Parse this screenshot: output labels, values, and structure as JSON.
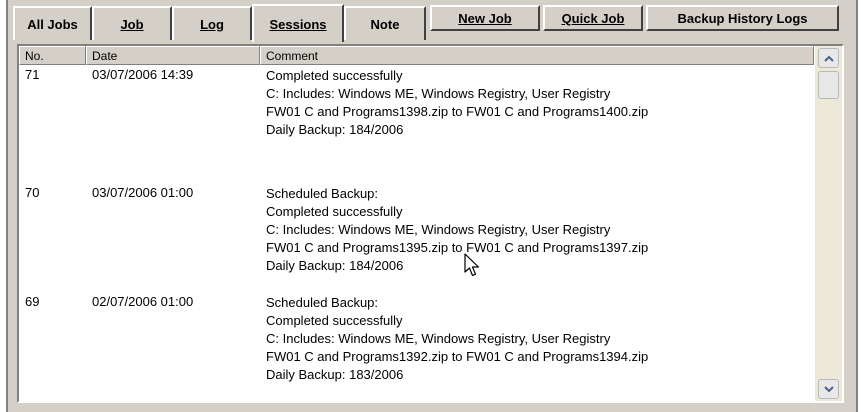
{
  "tabs": [
    {
      "label": "All Jobs",
      "active": false
    },
    {
      "label": "Job",
      "active": false
    },
    {
      "label": "Log",
      "active": false
    },
    {
      "label": "Sessions",
      "active": true
    },
    {
      "label": "Note",
      "active": false
    }
  ],
  "buttons": {
    "new_job": "New Job",
    "quick_job": "Quick Job",
    "backup_history_logs": "Backup History Logs"
  },
  "table": {
    "columns": [
      "No.",
      "Date",
      "Comment"
    ],
    "rows": [
      {
        "no": "71",
        "date": "03/07/2006 14:39",
        "comment": [
          "Completed successfully",
          "C: Includes: Windows ME, Windows Registry, User Registry",
          "FW01 C and Programs1398.zip to FW01 C and Programs1400.zip",
          "Daily Backup: 184/2006"
        ]
      },
      {
        "no": "70",
        "date": "03/07/2006 01:00",
        "comment": [
          "Scheduled Backup:",
          "Completed successfully",
          "C: Includes: Windows ME, Windows Registry, User Registry",
          "FW01 C and Programs1395.zip to FW01 C and Programs1397.zip",
          "Daily Backup: 184/2006"
        ]
      },
      {
        "no": "69",
        "date": "02/07/2006 01:00",
        "comment": [
          "Scheduled Backup:",
          "Completed successfully",
          "C: Includes: Windows ME, Windows Registry, User Registry",
          "FW01 C and Programs1392.zip to FW01 C and Programs1394.zip",
          "Daily Backup: 183/2006"
        ]
      }
    ]
  },
  "icons": {
    "scroll_up": "chevron-up-icon",
    "scroll_down": "chevron-down-icon",
    "cursor": "mouse-pointer-icon"
  },
  "colors": {
    "window_bg": "#d4d0c8",
    "list_bg": "#ffffff",
    "scrollbar_bg": "#ece9d8"
  }
}
